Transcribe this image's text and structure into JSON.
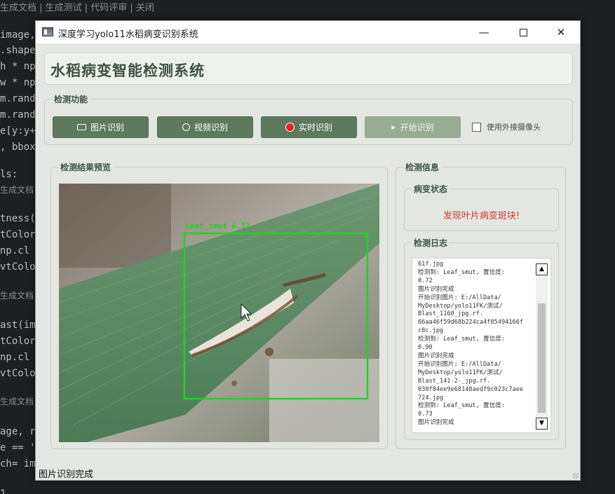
{
  "ide": {
    "top_bar": "生成文档 | 生成测试 | 代码评审 | 关闭",
    "code_lines": [
      {
        "text": "image,"
      },
      {
        "text": ".shape"
      },
      {
        "text": "h * np"
      },
      {
        "text": "w * np"
      },
      {
        "text": "m.rand"
      },
      {
        "text": "m.rand"
      },
      {
        "text": "e[y:y+"
      },
      {
        "text": ", bbox"
      },
      {
        "text": "ls:"
      },
      {
        "text": "tness("
      },
      {
        "text": "tColor"
      },
      {
        "text": " np.cl"
      },
      {
        "text": "vtColo"
      },
      {
        "text": "ast(im"
      },
      {
        "text": "tColor"
      },
      {
        "text": " np.cl"
      },
      {
        "text": "vtColo"
      },
      {
        "text": "age, r"
      },
      {
        "text": "e == '"
      },
      {
        "text": "ch= im"
      },
      {
        "text": "1"
      }
    ],
    "hints": [
      "生成文档",
      "生成文档",
      "生成文档",
      "生成文档"
    ]
  },
  "window": {
    "title": "深度学习yolo11水稻病变识别系统",
    "controls": {
      "minimize": "—",
      "close": "✕"
    }
  },
  "header": {
    "title": "水稻病变智能检测系统"
  },
  "functions": {
    "group_title": "检测功能",
    "buttons": [
      {
        "label": "图片识别",
        "icon": "camera-icon"
      },
      {
        "label": "视频识别",
        "icon": "film-icon"
      },
      {
        "label": "实时识别",
        "icon": "record-icon"
      },
      {
        "label": "开始识别",
        "icon": "play-icon"
      }
    ],
    "external_camera_label": "使用外接摄像头",
    "external_camera_checked": false
  },
  "preview": {
    "group_title": "检测结果预览",
    "detection_label": "Leaf_smut 0.73",
    "box_color": "#1fd41f"
  },
  "info": {
    "group_title": "检测信息",
    "status_title": "病变状态",
    "status_text": "发现叶片病变斑块!",
    "status_color": "#d1372c",
    "log_title": "检测日志",
    "log_lines": [
      "61f.jpg",
      "检测到: Leaf_smut, 置信度:",
      "0.72",
      "图片识别完成",
      "开始识别图片: E:/AllData/",
      "MyDesktop/yolo11FK/测试/",
      "Blast_1160_jpg.rf.",
      "66aa46f59d68b224ca4f85494166f",
      "c8c.jpg",
      "检测到: Leaf_smut, 置信度:",
      "0.90",
      "图片识别完成",
      "开始识别图片: E:/AllData/",
      "MyDesktop/yolo11FK/测试/",
      "Blast_141-2-_jpg.rf.",
      "030f84ee9e68148aedf9c023c7aee",
      "724.jpg",
      "检测到: Leaf_smut, 置信度:",
      "0.73",
      "图片识别完成"
    ]
  },
  "statusbar": {
    "text": "图片识别完成"
  },
  "colors": {
    "accent": "#5d7a5e",
    "window_bg": "#e4e7e1",
    "title_color": "#3d5142"
  }
}
